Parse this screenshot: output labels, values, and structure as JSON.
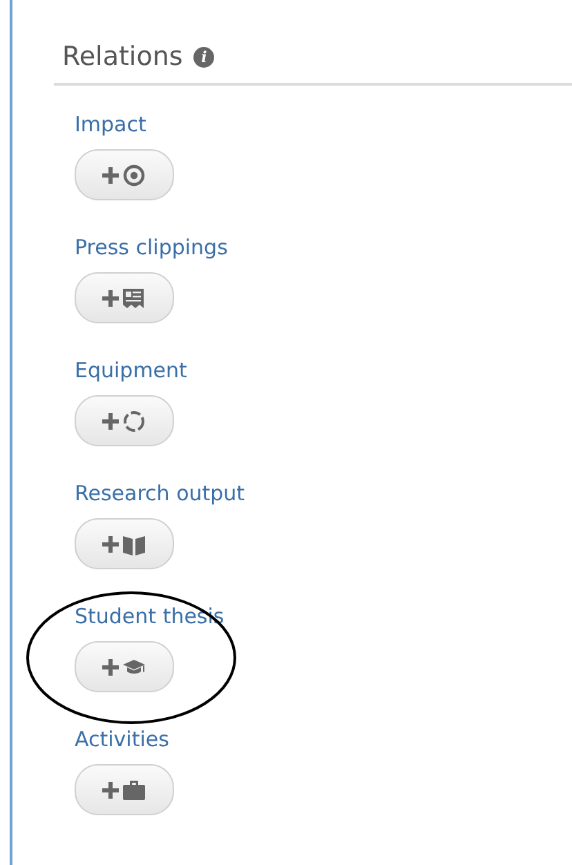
{
  "section": {
    "title": "Relations",
    "info_icon": "i"
  },
  "items": [
    {
      "label": "Impact",
      "kind": "target",
      "circled": false
    },
    {
      "label": "Press clippings",
      "kind": "clipping",
      "circled": false
    },
    {
      "label": "Equipment",
      "kind": "ring",
      "circled": false
    },
    {
      "label": "Research output",
      "kind": "book",
      "circled": false
    },
    {
      "label": "Student thesis",
      "kind": "cap",
      "circled": true
    },
    {
      "label": "Activities",
      "kind": "briefcase",
      "circled": false
    }
  ]
}
